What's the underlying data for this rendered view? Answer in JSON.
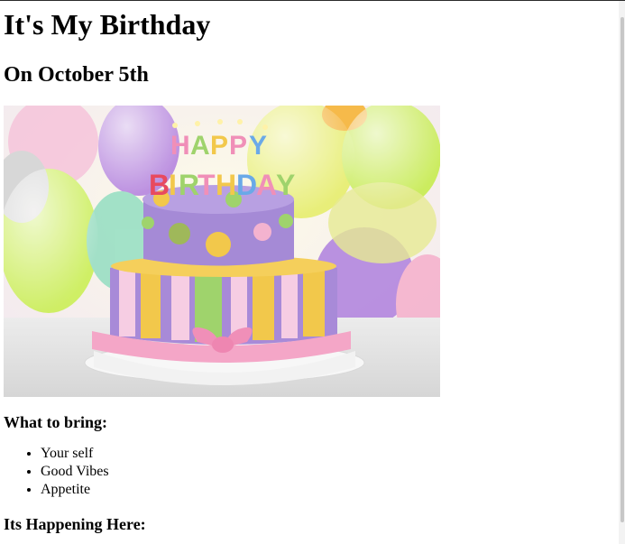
{
  "title": "It's My Birthday",
  "subtitle": "On October 5th",
  "image": {
    "alt": "birthday-cake-icon",
    "cake_topper_text_1": "HAPPY",
    "cake_topper_text_2": "BIRTHDAY"
  },
  "bring": {
    "heading": "What to bring:",
    "items": [
      "Your self",
      "Good Vibes",
      "Appetite"
    ]
  },
  "location": {
    "heading": "Its Happening Here:"
  },
  "colors": {
    "cake_purple": "#a58ad6",
    "stripe_yellow": "#f2c84b",
    "stripe_green": "#9fd36c",
    "ribbon_pink": "#f4a6c7",
    "balloon_green": "#c8ea5d",
    "balloon_purple": "#b58be0"
  }
}
